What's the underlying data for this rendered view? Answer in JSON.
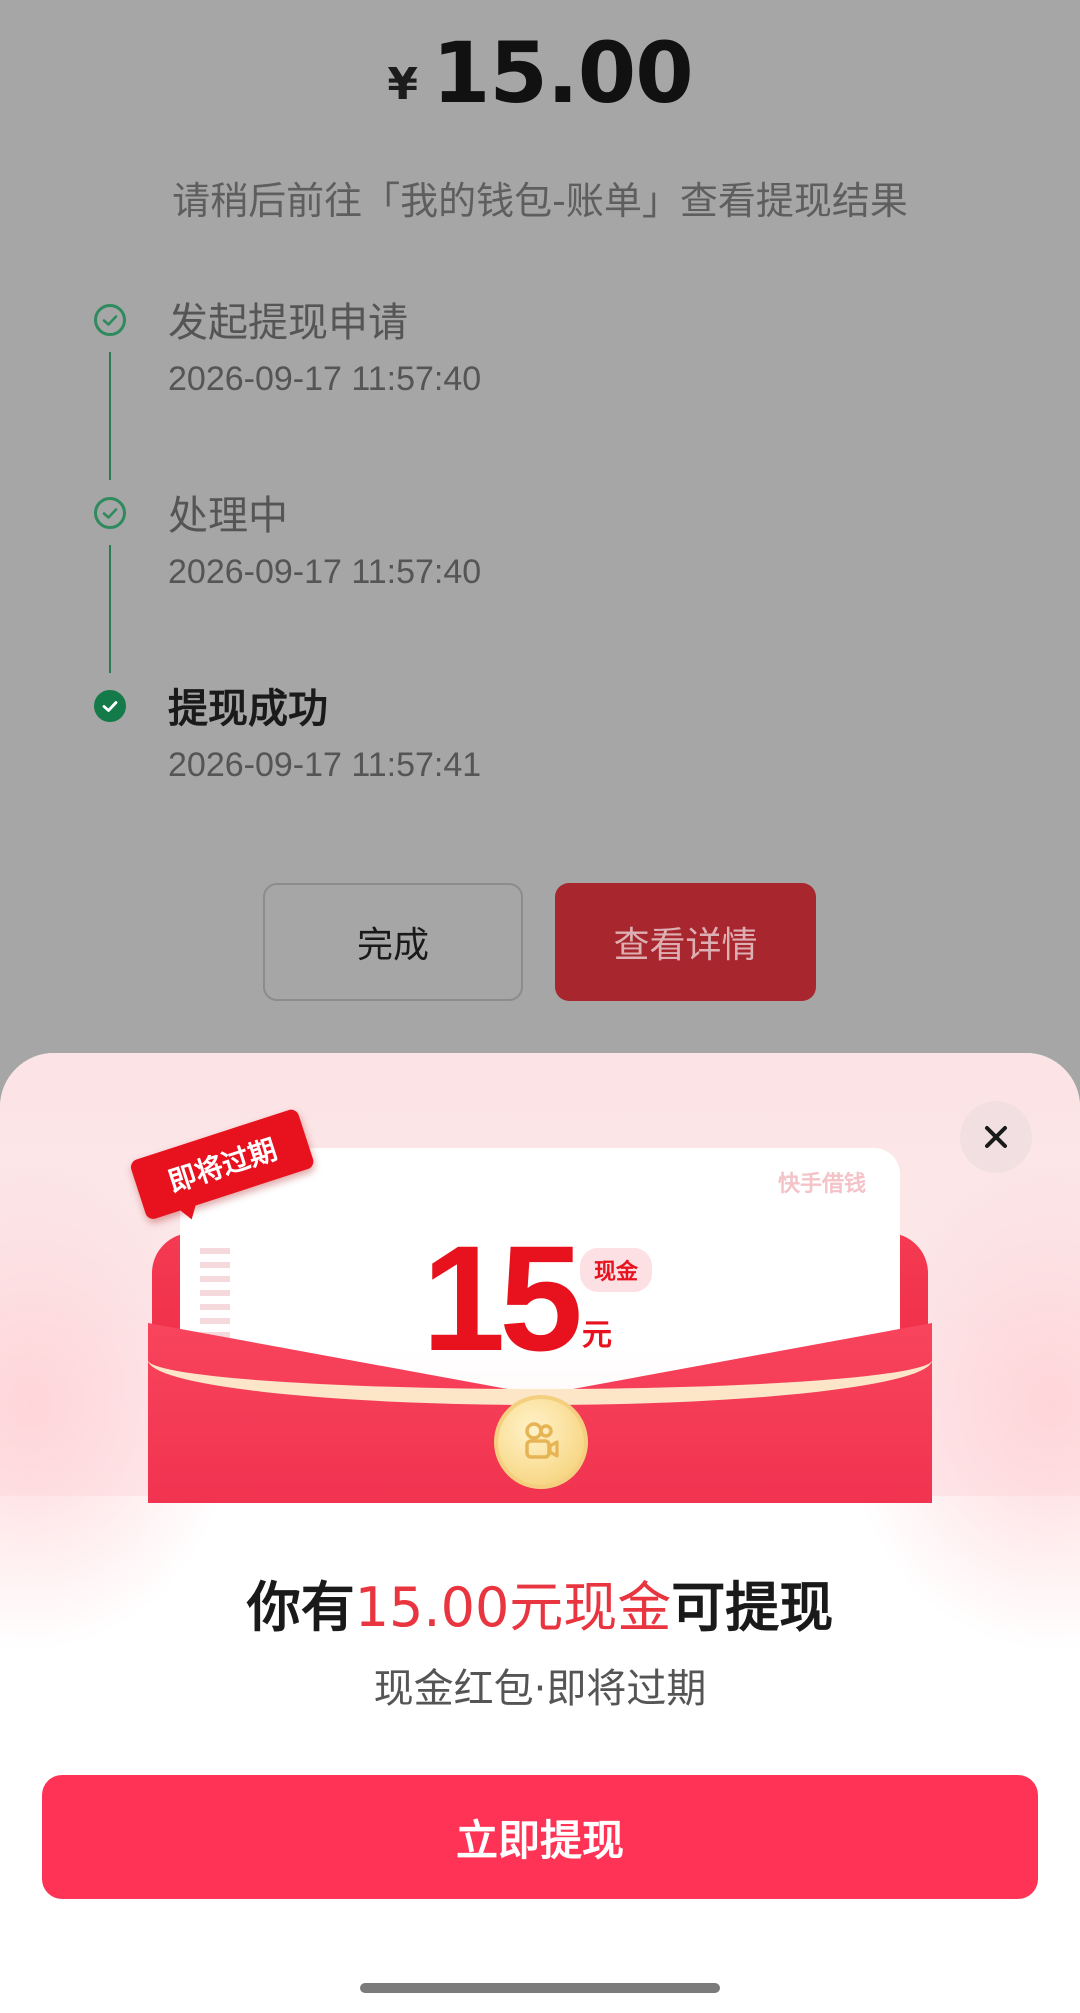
{
  "result": {
    "currency": "¥",
    "amount": "15.00",
    "hint": "请稍后前往「我的钱包-账单」查看提现结果"
  },
  "timeline": [
    {
      "title": "发起提现申请",
      "time": "2026-09-17 11:57:40",
      "state": "checked"
    },
    {
      "title": "处理中",
      "time": "2026-09-17 11:57:40",
      "state": "checked"
    },
    {
      "title": "提现成功",
      "time": "2026-09-17 11:57:41",
      "state": "done"
    }
  ],
  "buttons": {
    "done_label": "完成",
    "detail_label": "查看详情"
  },
  "popup": {
    "badge": "即将过期",
    "brand": "快手借钱",
    "card_amount": "15",
    "card_tag": "现金",
    "card_unit": "元",
    "headline_prefix": "你有",
    "headline_highlight": "15.00元现金",
    "headline_suffix": "可提现",
    "subtitle": "现金红包·即将过期",
    "withdraw_label": "立即提现",
    "icons": {
      "close": "close-icon",
      "coin": "kuaishou-camera-icon"
    }
  },
  "colors": {
    "accent_red": "#e8121f",
    "button_pink": "#fe3355",
    "success_green": "#157a4a",
    "detail_button": "#a8262e"
  }
}
